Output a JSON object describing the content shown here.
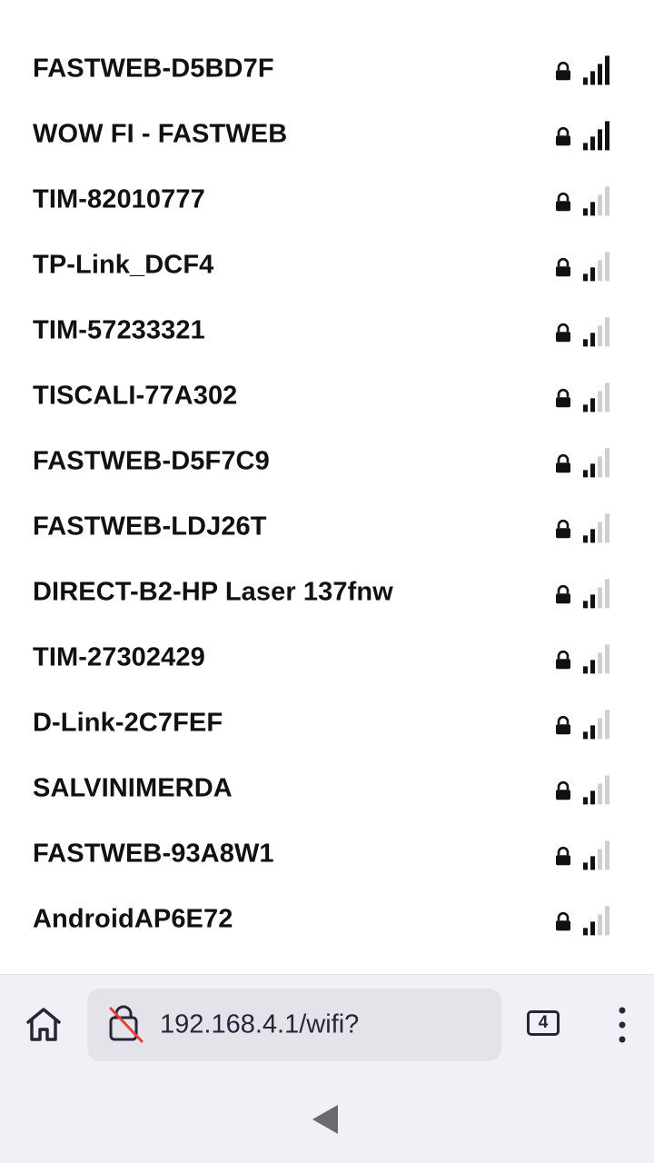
{
  "networks": [
    {
      "ssid": "FASTWEB-D5BD7F",
      "secured": true,
      "signal_bars": 4
    },
    {
      "ssid": "WOW FI - FASTWEB",
      "secured": true,
      "signal_bars": 4
    },
    {
      "ssid": "TIM-82010777",
      "secured": true,
      "signal_bars": 2
    },
    {
      "ssid": "TP-Link_DCF4",
      "secured": true,
      "signal_bars": 2
    },
    {
      "ssid": "TIM-57233321",
      "secured": true,
      "signal_bars": 2
    },
    {
      "ssid": "TISCALI-77A302",
      "secured": true,
      "signal_bars": 2
    },
    {
      "ssid": "FASTWEB-D5F7C9",
      "secured": true,
      "signal_bars": 2
    },
    {
      "ssid": "FASTWEB-LDJ26T",
      "secured": true,
      "signal_bars": 2
    },
    {
      "ssid": "DIRECT-B2-HP Laser 137fnw",
      "secured": true,
      "signal_bars": 2
    },
    {
      "ssid": "TIM-27302429",
      "secured": true,
      "signal_bars": 2
    },
    {
      "ssid": "D-Link-2C7FEF",
      "secured": true,
      "signal_bars": 2
    },
    {
      "ssid": "SALVINIMERDA",
      "secured": true,
      "signal_bars": 2
    },
    {
      "ssid": "FASTWEB-93A8W1",
      "secured": true,
      "signal_bars": 2
    },
    {
      "ssid": "AndroidAP6E72",
      "secured": true,
      "signal_bars": 2
    }
  ],
  "browser": {
    "url": "192.168.4.1/wifi?",
    "tab_count": "4",
    "icons": {
      "home": "home-icon",
      "insecure": "insecure-lock-icon",
      "tabs": "tabs-icon",
      "menu": "more-vert-icon",
      "back": "back-triangle-icon"
    }
  },
  "colors": {
    "signal_active": "#111111",
    "signal_inactive": "#cfcfcf",
    "insecure_slash": "#e0443a",
    "browser_bar": "#f2f0f6",
    "url_box": "#e5e3ea"
  }
}
